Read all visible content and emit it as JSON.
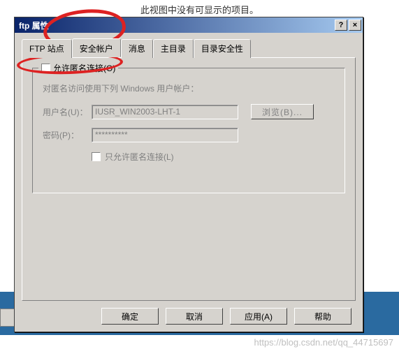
{
  "top_caption": "此视图中没有可显示的项目。",
  "dialog": {
    "title": "ftp 属性",
    "help_btn": "?",
    "close_btn": "×",
    "tabs": [
      "FTP 站点",
      "安全帐户",
      "消息",
      "主目录",
      "目录安全性"
    ],
    "active_tab_index": 1,
    "group_check_label": "允许匿名连接(O)",
    "desc": "对匿名访问使用下列 Windows 用户帐户：",
    "username_label": "用户名(U)：",
    "username_value": "IUSR_WIN2003-LHT-1",
    "browse_label": "浏览(B)...",
    "password_label": "密码(P)：",
    "password_value": "**********",
    "only_anon_label": "只允许匿名连接(L)",
    "buttons": {
      "ok": "确定",
      "cancel": "取消",
      "apply": "应用(A)",
      "help": "帮助"
    }
  },
  "watermark": "https://blog.csdn.net/qq_44715697"
}
